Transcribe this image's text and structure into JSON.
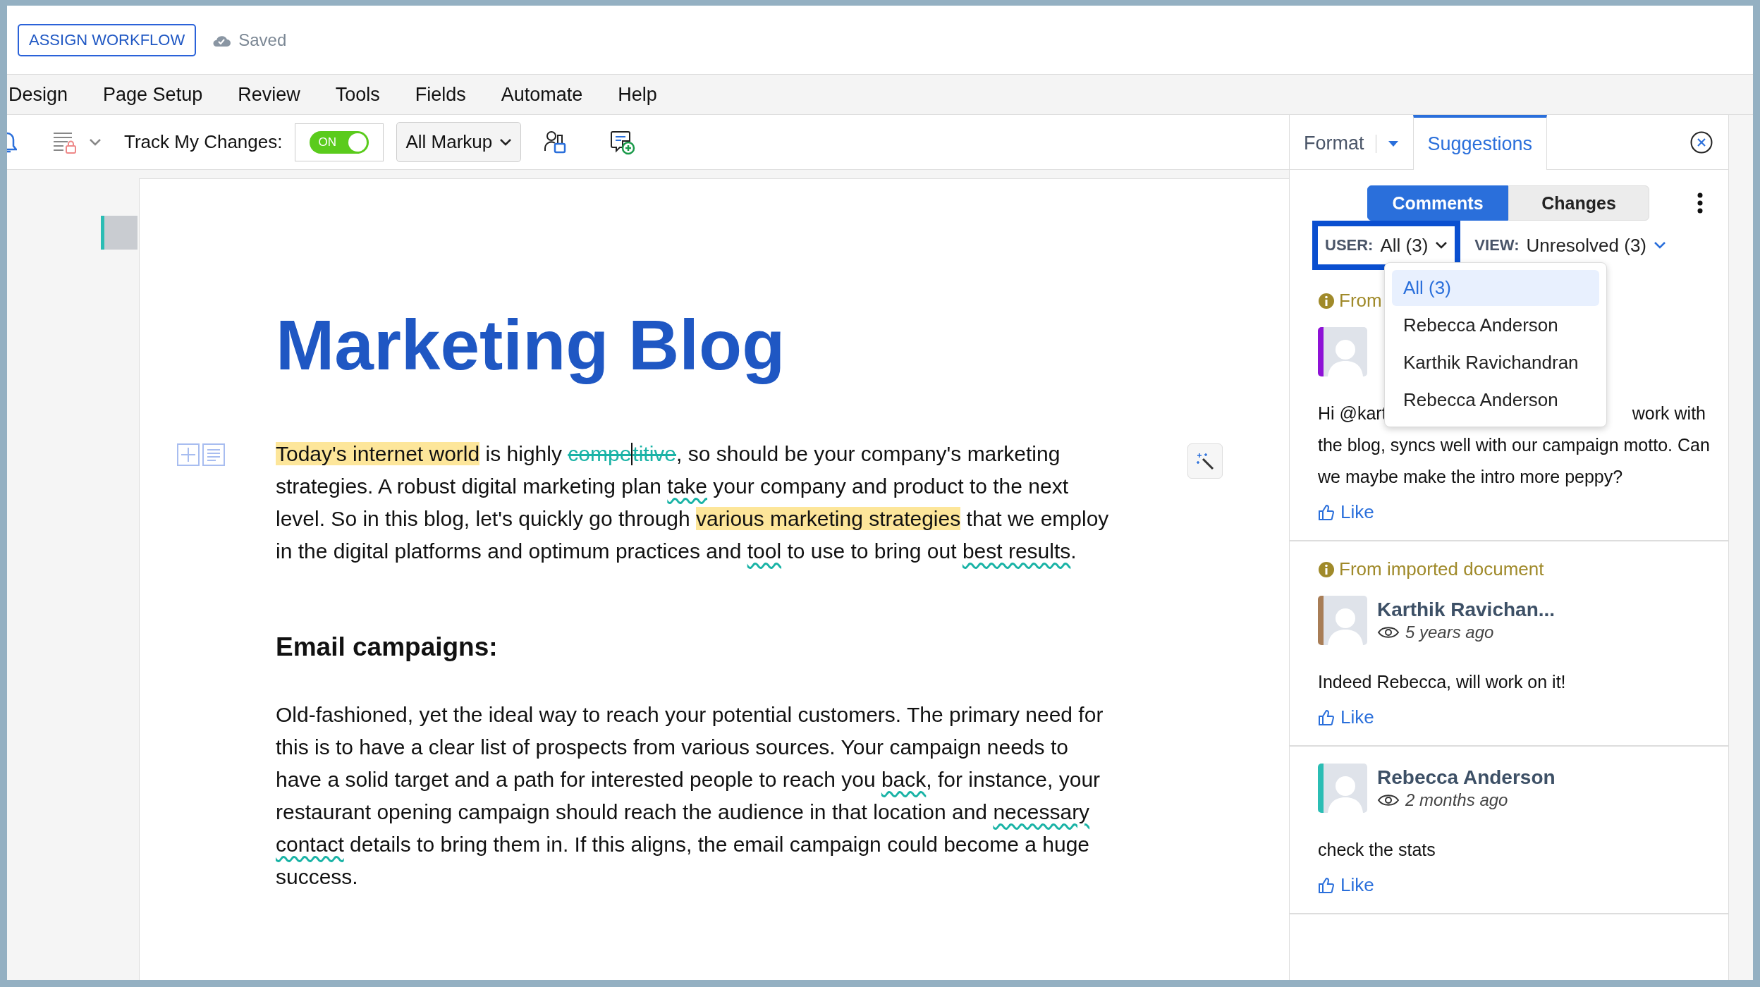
{
  "top_bar": {
    "assign_button": "ASSIGN WORKFLOW",
    "save_status": "Saved"
  },
  "menu": [
    {
      "label": "Design"
    },
    {
      "label": "Page Setup"
    },
    {
      "label": "Review"
    },
    {
      "label": "Tools"
    },
    {
      "label": "Fields"
    },
    {
      "label": "Automate"
    },
    {
      "label": "Help"
    }
  ],
  "toolbar": {
    "track_label": "Track My Changes:",
    "track_toggle": {
      "label": "ON",
      "on": true
    },
    "markup_select": "All Markup"
  },
  "document": {
    "title": "Marketing Blog",
    "blocks": [
      {
        "kind": "paragraph",
        "segments": [
          {
            "kind": "highlight",
            "text": "Today's internet world"
          },
          {
            "kind": "plain",
            "text": " is highly "
          },
          {
            "kind": "deleted",
            "text": "compe"
          },
          {
            "kind": "caret"
          },
          {
            "kind": "deleted",
            "text": "titive"
          },
          {
            "kind": "plain",
            "text": ", so should be your company's marketing strategies. A robust digital marketing plan "
          },
          {
            "kind": "flagged",
            "text": "take"
          },
          {
            "kind": "plain",
            "text": " your company and product to the next level. So in this blog, let's quickly go through "
          },
          {
            "kind": "highlight",
            "text": "various marketing strategies"
          },
          {
            "kind": "plain",
            "text": " that we employ in the digital platforms and optimum practices and "
          },
          {
            "kind": "flagged",
            "text": "tool"
          },
          {
            "kind": "plain",
            "text": " to use to bring out "
          },
          {
            "kind": "flagged",
            "text": "best results"
          },
          {
            "kind": "plain",
            "text": "."
          }
        ]
      },
      {
        "kind": "heading",
        "text": "Email campaigns:"
      },
      {
        "kind": "paragraph",
        "segments": [
          {
            "kind": "plain",
            "text": "Old-fashioned, yet the ideal way to reach your potential customers. The primary need for this is to have a clear list of prospects from various sources. Your campaign needs to have a solid target and a path for interested people to reach you "
          },
          {
            "kind": "flagged",
            "text": "back"
          },
          {
            "kind": "plain",
            "text": ", for instance, your restaurant opening campaign should reach the audience in that location and "
          },
          {
            "kind": "flagged",
            "text": "necessary contact"
          },
          {
            "kind": "plain",
            "text": " details to bring them in. If this aligns, the email campaign could become a huge success."
          }
        ]
      }
    ]
  },
  "panel": {
    "tabs": [
      {
        "label": "Format",
        "selected": false,
        "has_menu": true
      },
      {
        "label": "Suggestions",
        "selected": true,
        "has_menu": false
      }
    ],
    "view_switch": [
      {
        "label": "Comments",
        "selected": true
      },
      {
        "label": "Changes",
        "selected": false
      }
    ],
    "user_filter": {
      "label": "USER:",
      "value": "All (3)"
    },
    "view_filter": {
      "label": "VIEW:",
      "value": "Unresolved (3)"
    },
    "user_menu": [
      {
        "label": "All (3)",
        "selected": true
      },
      {
        "label": "Rebecca Anderson",
        "selected": false
      },
      {
        "label": "Karthik Ravichandran",
        "selected": false
      },
      {
        "label": "Rebecca Anderson",
        "selected": false
      }
    ],
    "comments": [
      {
        "source_note": "From",
        "color": "#8e12d6",
        "first_line": [
          "Hi @kart",
          "work with"
        ],
        "body": "the blog, syncs well with our campaign motto. Can we maybe make the intro more peppy?",
        "like": "Like"
      },
      {
        "source_note": "From imported document",
        "color": "#a87d56",
        "author": "Karthik Ravichan...",
        "time": "5 years ago",
        "body": "Indeed Rebecca, will work on it!",
        "like": "Like"
      },
      {
        "color": "#2bbdb4",
        "author": "Rebecca Anderson",
        "time": "2 months ago",
        "body": "check the stats",
        "like": "Like"
      }
    ]
  }
}
